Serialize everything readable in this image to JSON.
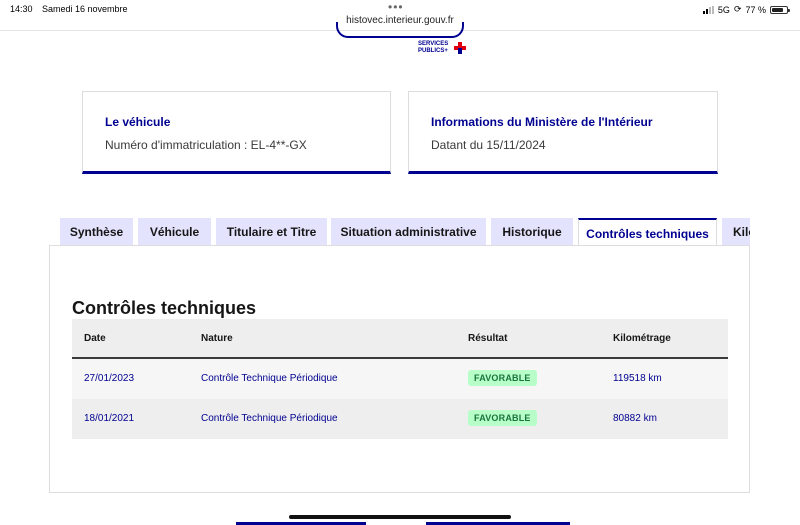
{
  "statusbar": {
    "time": "14:30",
    "date": "Samedi 16 novembre",
    "network": "5G",
    "battery": "77 %",
    "battery_level": 0.77
  },
  "browser": {
    "url": "histovec.interieur.gouv.fr"
  },
  "header": {
    "logo_line1": "SERVICES",
    "logo_line2": "PUBLICS+"
  },
  "cards": {
    "vehicle": {
      "title": "Le véhicule",
      "text": "Numéro d'immatriculation : EL-4**-GX"
    },
    "ministry": {
      "title": "Informations du Ministère de l'Intérieur",
      "text": "Datant du 15/11/2024"
    }
  },
  "tabs": [
    {
      "label": "Synthèse"
    },
    {
      "label": "Véhicule"
    },
    {
      "label": "Titulaire et Titre"
    },
    {
      "label": "Situation administrative"
    },
    {
      "label": "Historique"
    },
    {
      "label": "Contrôles techniques",
      "active": true
    },
    {
      "label": "Kilo"
    }
  ],
  "panel": {
    "title": "Contrôles techniques",
    "columns": [
      "Date",
      "Nature",
      "Résultat",
      "Kilométrage"
    ],
    "rows": [
      {
        "date": "27/01/2023",
        "nature": "Contrôle Technique Périodique",
        "result": "FAVORABLE",
        "km": "119518 km"
      },
      {
        "date": "18/01/2021",
        "nature": "Contrôle Technique Périodique",
        "result": "FAVORABLE",
        "km": "80882 km"
      }
    ]
  },
  "colors": {
    "primary": "#000091",
    "tab_bg": "#e3e3fd",
    "success_bg": "#b8fec9",
    "success_text": "#18753c"
  }
}
